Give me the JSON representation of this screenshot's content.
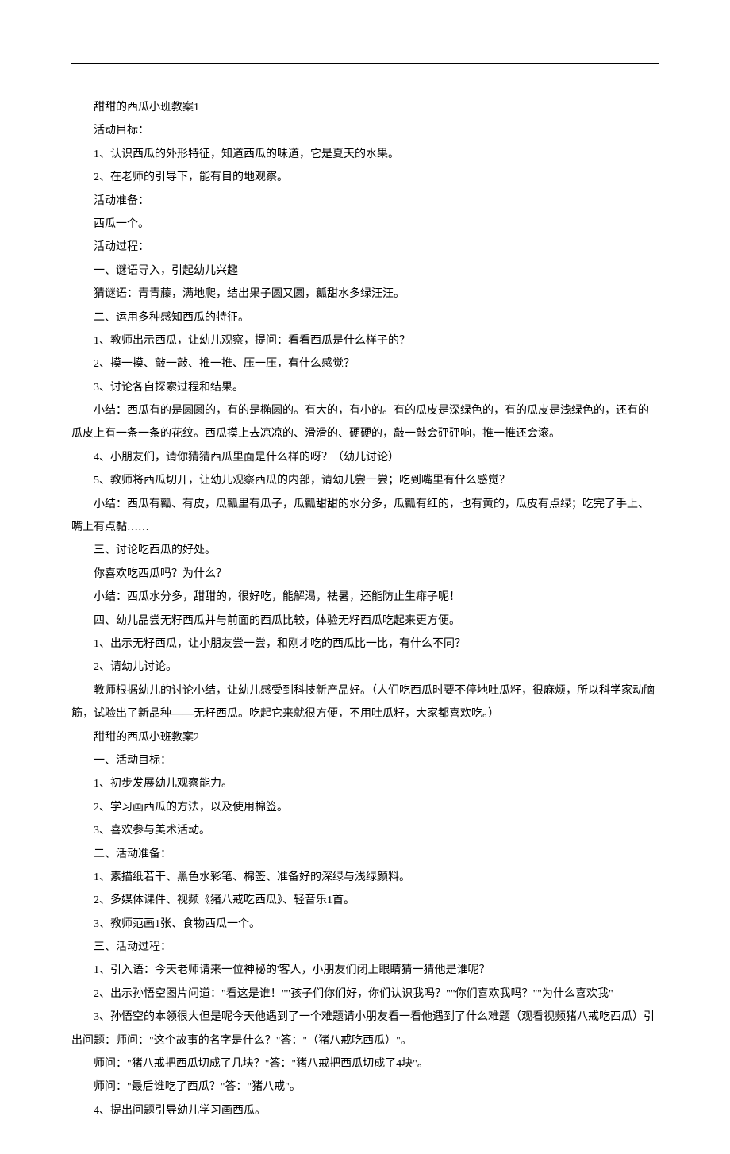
{
  "lines": [
    "甜甜的西瓜小班教案1",
    "活动目标：",
    "1、认识西瓜的外形特征，知道西瓜的味道，它是夏天的水果。",
    "2、在老师的引导下，能有目的地观察。",
    "活动准备：",
    "西瓜一个。",
    "活动过程：",
    "一、谜语导入，引起幼儿兴趣",
    "猜谜语：青青藤，满地爬，结出果子圆又圆，瓤甜水多绿汪汪。",
    "二、运用多种感知西瓜的特征。",
    "1、教师出示西瓜，让幼儿观察，提问：看看西瓜是什么样子的？",
    "2、摸一摸、敲一敲、推一推、压一压，有什么感觉？",
    "3、讨论各自探索过程和结果。",
    "小结：西瓜有的是圆圆的，有的是椭圆的。有大的，有小的。有的瓜皮是深绿色的，有的瓜皮是浅绿色的，还有的瓜皮上有一条一条的花纹。西瓜摸上去凉凉的、滑滑的、硬硬的，敲一敲会砰砰响，推一推还会滚。",
    "4、小朋友们，请你猜猜西瓜里面是什么样的呀？（幼儿讨论）",
    "5、教师将西瓜切开，让幼儿观察西瓜的内部，请幼儿尝一尝；吃到嘴里有什么感觉？",
    "小结：西瓜有瓤、有皮，瓜瓤里有瓜子，瓜瓤甜甜的水分多，瓜瓤有红的，也有黄的，瓜皮有点绿；吃完了手上、嘴上有点黏……",
    "三、讨论吃西瓜的好处。",
    "你喜欢吃西瓜吗？为什么？",
    "小结：西瓜水分多，甜甜的，很好吃，能解渴，祛暑，还能防止生痱子呢！",
    "四、幼儿品尝无籽西瓜并与前面的西瓜比较，体验无籽西瓜吃起来更方便。",
    "1、出示无籽西瓜，让小朋友尝一尝，和刚才吃的西瓜比一比，有什么不同？",
    "2、请幼儿讨论。",
    "教师根据幼儿的讨论小结，让幼儿感受到科技新产品好。（人们吃西瓜时要不停地吐瓜籽，很麻烦，所以科学家动脑筋，试验出了新品种——无籽西瓜。吃起它来就很方便，不用吐瓜籽，大家都喜欢吃。）",
    "甜甜的西瓜小班教案2",
    "一、活动目标：",
    "1、初步发展幼儿观察能力。",
    "2、学习画西瓜的方法，以及使用棉签。",
    "3、喜欢参与美术活动。",
    "二、活动准备：",
    "1、素描纸若干、黑色水彩笔、棉签、准备好的深绿与浅绿颜料。",
    "2、多媒体课件、视频《猪八戒吃西瓜》、轻音乐1首。",
    "3、教师范画1张、食物西瓜一个。",
    "三、活动过程：",
    "1、引入语：今天老师请来一位神秘的'客人，小朋友们闭上眼睛猜一猜他是谁呢？",
    "2、出示孙悟空图片问道：\"看这是谁！\"\"孩子们你们好，你们认识我吗？\"\"你们喜欢我吗？\"\"为什么喜欢我\"",
    "3、孙悟空的本领很大但是呢今天他遇到了一个难题请小朋友看一看他遇到了什么难题（观看视频猪八戒吃西瓜）引出问题：师问：\"这个故事的名字是什么？\"答：\"（猪八戒吃西瓜）\"。",
    "师问：\"猪八戒把西瓜切成了几块？\"答：\"猪八戒把西瓜切成了4块\"。",
    "师问：\"最后谁吃了西瓜？\"答：\"猪八戒\"。",
    "4、提出问题引导幼儿学习画西瓜。"
  ],
  "multiLineIndexes": [
    13,
    16,
    23,
    36
  ]
}
